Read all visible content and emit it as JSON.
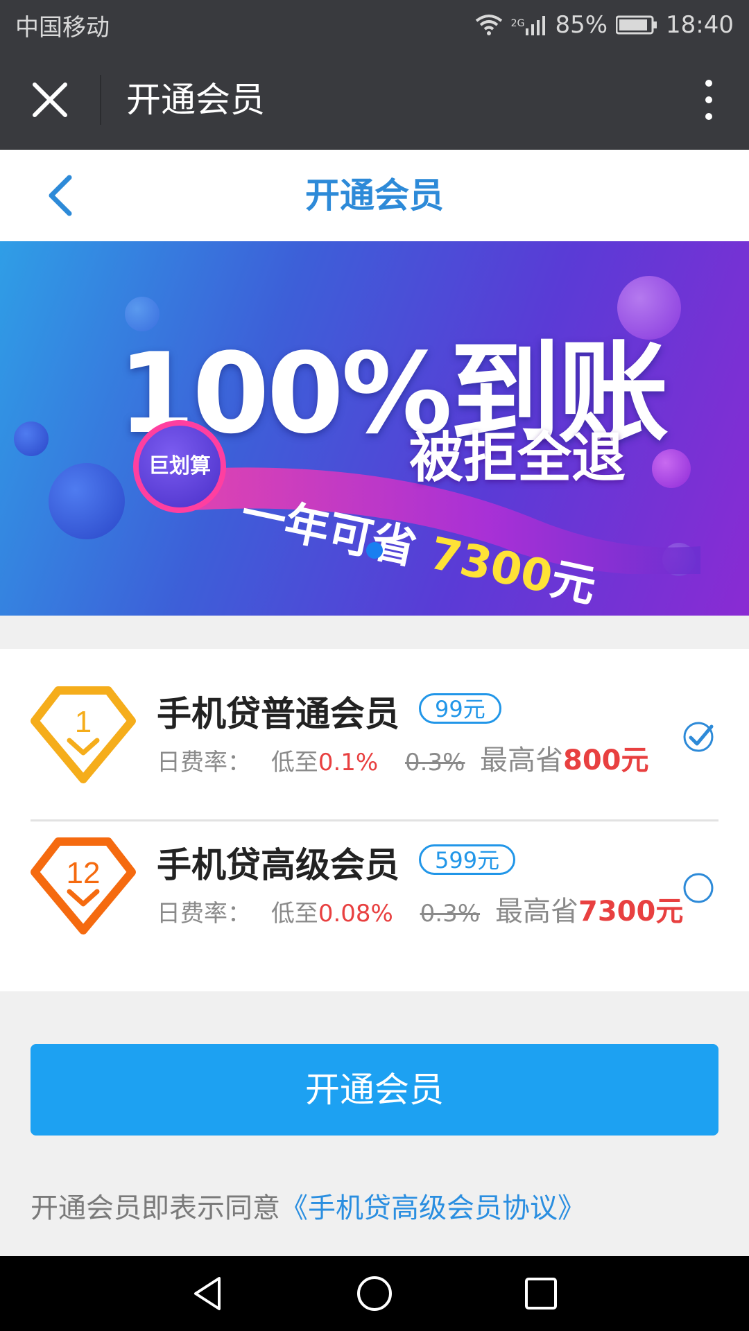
{
  "status_bar": {
    "carrier": "中国移动",
    "network": "2G",
    "battery": "85%",
    "time": "18:40"
  },
  "wechat_bar": {
    "title": "开通会员",
    "close_icon": "close-icon",
    "more_icon": "more-vertical-icon"
  },
  "header": {
    "title": "开通会员",
    "back_icon": "chevron-left-icon"
  },
  "banner": {
    "headline": "100%到账",
    "subline": "被拒全退",
    "badge": "巨划算",
    "save_prefix": "一年可省",
    "save_amount": "7300",
    "save_unit": "元"
  },
  "plans": [
    {
      "level": "1",
      "name": "手机贷普通会员",
      "price": "99元",
      "rate_label": "日费率：",
      "rate_prefix": "低至",
      "rate": "0.1%",
      "original_rate": "0.3%",
      "save_label": "最高省",
      "save_amount": "800元",
      "selected": true,
      "color": "#f5ad1b"
    },
    {
      "level": "12",
      "name": "手机贷高级会员",
      "price": "599元",
      "rate_label": "日费率：",
      "rate_prefix": "低至",
      "rate": "0.08%",
      "original_rate": "0.3%",
      "save_label": "最高省",
      "save_amount": "7300元",
      "selected": false,
      "color": "#f56a0f"
    }
  ],
  "cta": {
    "label": "开通会员"
  },
  "agreement": {
    "text": "开通会员即表示同意",
    "link": "《手机贷高级会员协议》"
  },
  "nav": {
    "back_icon": "triangle-back-icon",
    "home_icon": "circle-home-icon",
    "recents_icon": "square-recents-icon"
  },
  "colors": {
    "accent": "#1da1f2",
    "title_blue": "#2d8ad8",
    "highlight_red": "#e84040"
  }
}
